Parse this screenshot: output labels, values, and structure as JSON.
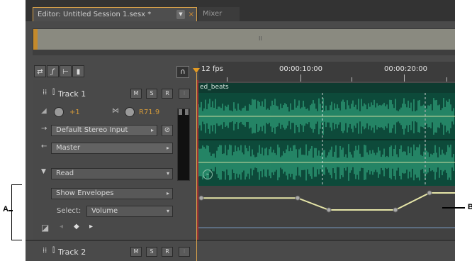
{
  "tabs": {
    "editor": "Editor: Untitled Session 1.sesx *",
    "editor_menu": "▼",
    "editor_close": "×",
    "mixer": "Mixer"
  },
  "overview": {
    "center_mark": "II"
  },
  "toolbar": {
    "icons": [
      "swap-icon",
      "fx-icon",
      "send-icon",
      "eq-icon"
    ],
    "headphone": "∩"
  },
  "track1": {
    "name": "Track 1",
    "m": "M",
    "s": "S",
    "r": "R",
    "i": "I",
    "volume": "+1",
    "pan": "R71.9",
    "input": "Default Stereo Input",
    "output": "Master",
    "automation_mode": "Read",
    "show_envelopes": "Show Envelopes",
    "select_label": "Select:",
    "select_value": "Volume"
  },
  "track2": {
    "name": "Track 2",
    "m": "M",
    "s": "S",
    "r": "R",
    "i": "I"
  },
  "ruler": {
    "fps": "12 fps",
    "t1": "00:00:10:00",
    "t2": "00:00:20:00"
  },
  "clip": {
    "name": "ed_beats"
  },
  "callouts": {
    "a": "A",
    "b": "B"
  },
  "colors": {
    "waveform": "#2e9e78",
    "clip_bg": "#0d4a3a",
    "envelope": "#e6e6a8",
    "accent": "#d9a24a"
  },
  "envelope": {
    "points_percent_y": [
      18,
      18,
      60,
      60,
      0,
      0
    ]
  }
}
